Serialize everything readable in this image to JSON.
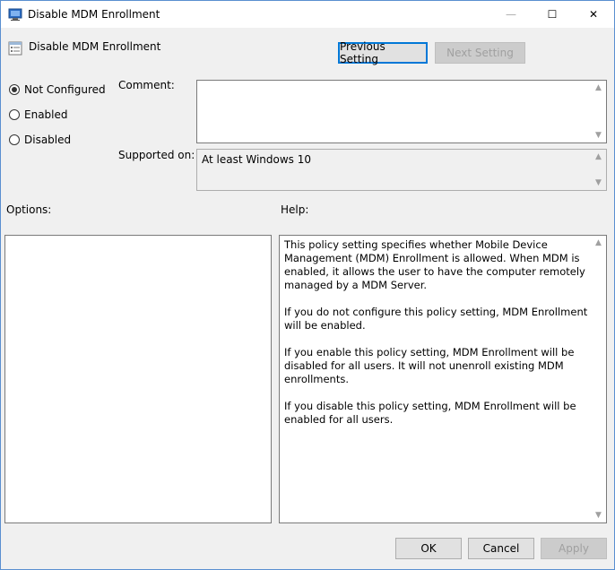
{
  "window": {
    "title": "Disable MDM Enrollment",
    "controls": {
      "minimize": "—",
      "maximize": "☐",
      "close": "✕"
    }
  },
  "header": {
    "policy_name": "Disable MDM Enrollment",
    "previous_label": "Previous Setting",
    "next_label": "Next Setting"
  },
  "state": {
    "options": [
      {
        "label": "Not Configured",
        "checked": true
      },
      {
        "label": "Enabled",
        "checked": false
      },
      {
        "label": "Disabled",
        "checked": false
      }
    ]
  },
  "comment": {
    "label": "Comment:",
    "value": ""
  },
  "supported": {
    "label": "Supported on:",
    "value": "At least Windows 10"
  },
  "options_panel": {
    "label": "Options:"
  },
  "help_panel": {
    "label": "Help:",
    "paragraphs": [
      "This policy setting specifies whether Mobile Device Management (MDM) Enrollment is allowed. When MDM is enabled, it allows the user to have the computer remotely managed by a MDM Server.",
      "If you do not configure this policy setting, MDM Enrollment will be enabled.",
      "If you enable this policy setting, MDM Enrollment will be disabled for all users. It will not unenroll existing MDM enrollments.",
      "If you disable this policy setting, MDM Enrollment will be enabled for all users."
    ]
  },
  "footer": {
    "ok_label": "OK",
    "cancel_label": "Cancel",
    "apply_label": "Apply"
  },
  "colors": {
    "accent": "#0078d7",
    "window_border": "#5a8fd0",
    "face": "#f0f0f0"
  },
  "icons": {
    "title": "policy-window-icon",
    "header": "policy-setting-icon"
  }
}
